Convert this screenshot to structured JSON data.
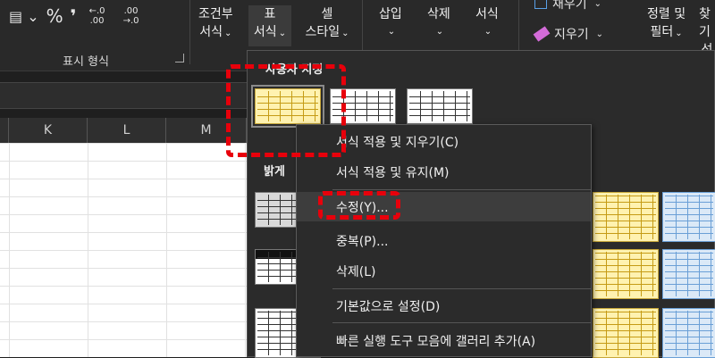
{
  "ribbon": {
    "number_format": {
      "currency_icon": "currency-icon",
      "percent": "%",
      "comma": "❜",
      "increase_decimal": "←.0 .00",
      "decrease_decimal": ".00 →.0",
      "group_label": "표시 형식"
    },
    "conditional_line1": "조건부",
    "conditional_line2": "서식",
    "table_line1": "표",
    "table_line2": "서식",
    "cell_line1": "셀",
    "cell_line2": "스타일",
    "insert": "삽입",
    "delete": "삭제",
    "format": "서식",
    "fill": "채우기",
    "clear": "지우기",
    "sort_line1": "정렬 및",
    "sort_line2": "필터",
    "find_line1": "찾기",
    "find_line2": "선",
    "dropdown_arrow": "⌄"
  },
  "columns": [
    "K",
    "L",
    "M"
  ],
  "gallery": {
    "custom_title": "사용자 지정",
    "light_title": "밝게"
  },
  "context_menu": {
    "items": [
      "서식 적용 및 지우기(C)",
      "서식 적용 및 유지(M)",
      "수정(Y)...",
      "중복(P)...",
      "삭제(L)",
      "기본값으로 설정(D)",
      "빠른 실행 도구 모음에 갤러리 추가(A)"
    ],
    "hover_index": 2
  },
  "colors": {
    "highlight": "#e8000b",
    "background": "#1f1f1f"
  }
}
